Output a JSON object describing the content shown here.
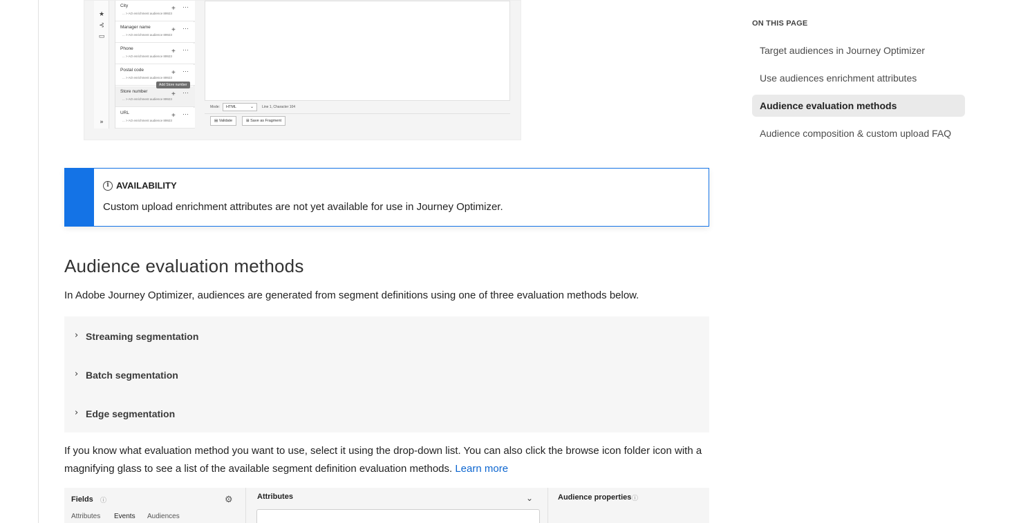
{
  "top_screenshot": {
    "fields": [
      {
        "name": "City",
        "path": "... > AO enrichment audience 89923"
      },
      {
        "name": "Manager name",
        "path": "... > AO enrichment audience 89923"
      },
      {
        "name": "Phone",
        "path": "... > AO enrichment audience 89923"
      },
      {
        "name": "Postal code",
        "path": "... > AO enrichment audience 89923"
      },
      {
        "name": "Store number",
        "path": "... > AO enrichment audience 89923"
      },
      {
        "name": "URL",
        "path": "... > AO enrichment audience 89923"
      }
    ],
    "tooltip": "Add Store number",
    "mode_label": "Mode:",
    "mode_value": "HTML",
    "line_char": "Line 1, Character 104",
    "validate_label": "Validate",
    "save_fragment_label": "Save as Fragment",
    "rail_expand": "»"
  },
  "alert": {
    "title": "AVAILABILITY",
    "body": "Custom upload enrichment attributes are not yet available for use in Journey Optimizer."
  },
  "section": {
    "title": "Audience evaluation methods",
    "intro": "In Adobe Journey Optimizer, audiences are generated from segment definitions using one of three evaluation methods below."
  },
  "accordion": [
    {
      "label": "Streaming segmentation"
    },
    {
      "label": "Batch segmentation"
    },
    {
      "label": "Edge segmentation"
    }
  ],
  "paragraph": {
    "text": "If you know what evaluation method you want to use, select it using the drop-down list. You can also click the browse icon folder icon with a magnifying glass to see a list of the available segment definition evaluation methods. ",
    "link": "Learn more"
  },
  "bottom_screenshot": {
    "fields_title": "Fields",
    "tabs": [
      "Attributes",
      "Events",
      "Audiences"
    ],
    "attributes_title": "Attributes",
    "audience_props_title": "Audience properties"
  },
  "toc": {
    "heading": "ON THIS PAGE",
    "items": [
      {
        "label": "Target audiences in Journey Optimizer",
        "active": false
      },
      {
        "label": "Use audiences enrichment attributes",
        "active": false
      },
      {
        "label": "Audience evaluation methods",
        "active": true
      },
      {
        "label": "Audience composition & custom upload FAQ",
        "active": false
      }
    ]
  }
}
